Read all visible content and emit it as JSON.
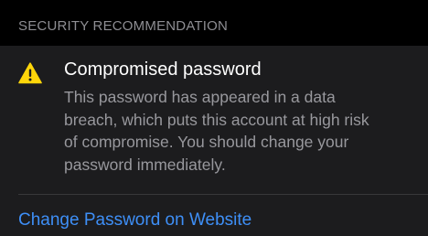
{
  "section": {
    "header": "SECURITY RECOMMENDATION"
  },
  "alert": {
    "icon": "warning-triangle-icon",
    "icon_color": "#ffd60a",
    "title": "Compromised password",
    "body_lines": [
      "This password has appeared in a data",
      "breach, which puts this account at high risk",
      "of compromise. You should change your",
      "password immediately."
    ]
  },
  "action": {
    "label": "Change Password on Website",
    "color": "#3e8ff7"
  },
  "colors": {
    "background": "#000000",
    "card": "#1c1c1e",
    "secondary_text": "#98989d",
    "header_text": "#8e8e93"
  }
}
